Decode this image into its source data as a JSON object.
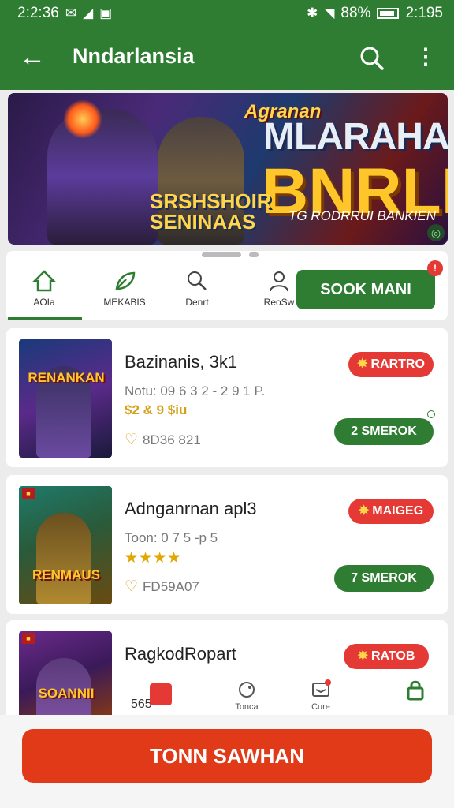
{
  "status_bar": {
    "time_left": "2:2:36",
    "battery": "88%",
    "time_right": "2:195"
  },
  "toolbar": {
    "back_label": "←",
    "title": "Nndarlansia",
    "more_label": "⋮"
  },
  "banner": {
    "top_text": "Agranan",
    "main_line1": "MLARAHAN",
    "main_line2": "BNRLI",
    "tagline_line1": "SRSHSHOIR",
    "tagline_line2": "SENINAAS",
    "subtitle": "TG RODRRUI BANKIEN"
  },
  "categories": [
    {
      "label": "AOIa"
    },
    {
      "label": "MEKABIS"
    },
    {
      "label": "Denrt"
    },
    {
      "label": "ReoSw"
    }
  ],
  "soon_button": {
    "label": "SOOK MANI",
    "badge": "!"
  },
  "games": [
    {
      "thumb_title_top": "RENANKAN",
      "name": "Bazinanis, 3k1",
      "meta": "Notu: 09 6 3 2 - 2 9 1 P.",
      "price": "$2 & 9 $iu",
      "likes": "8D36 821",
      "rate_label": "RARTRO",
      "action_label": "2 SMEROK"
    },
    {
      "thumb_title_top": "RENMAUS",
      "name": "Adnganrnan apl3",
      "meta": "Toon: 0 7 5 -p 5",
      "stars": "★★★★",
      "likes": "FD59A07",
      "rate_label": "MAIGEG",
      "action_label": "7 SMEROK"
    },
    {
      "thumb_title_top": "SOANNII",
      "name": "RagkodRopart",
      "rate_label": "RATOB",
      "count": "565"
    }
  ],
  "bottom_nav": [
    {
      "label": "Tonca"
    },
    {
      "label": "Cure"
    }
  ],
  "cta": {
    "label": "TONN SAWHAN"
  }
}
